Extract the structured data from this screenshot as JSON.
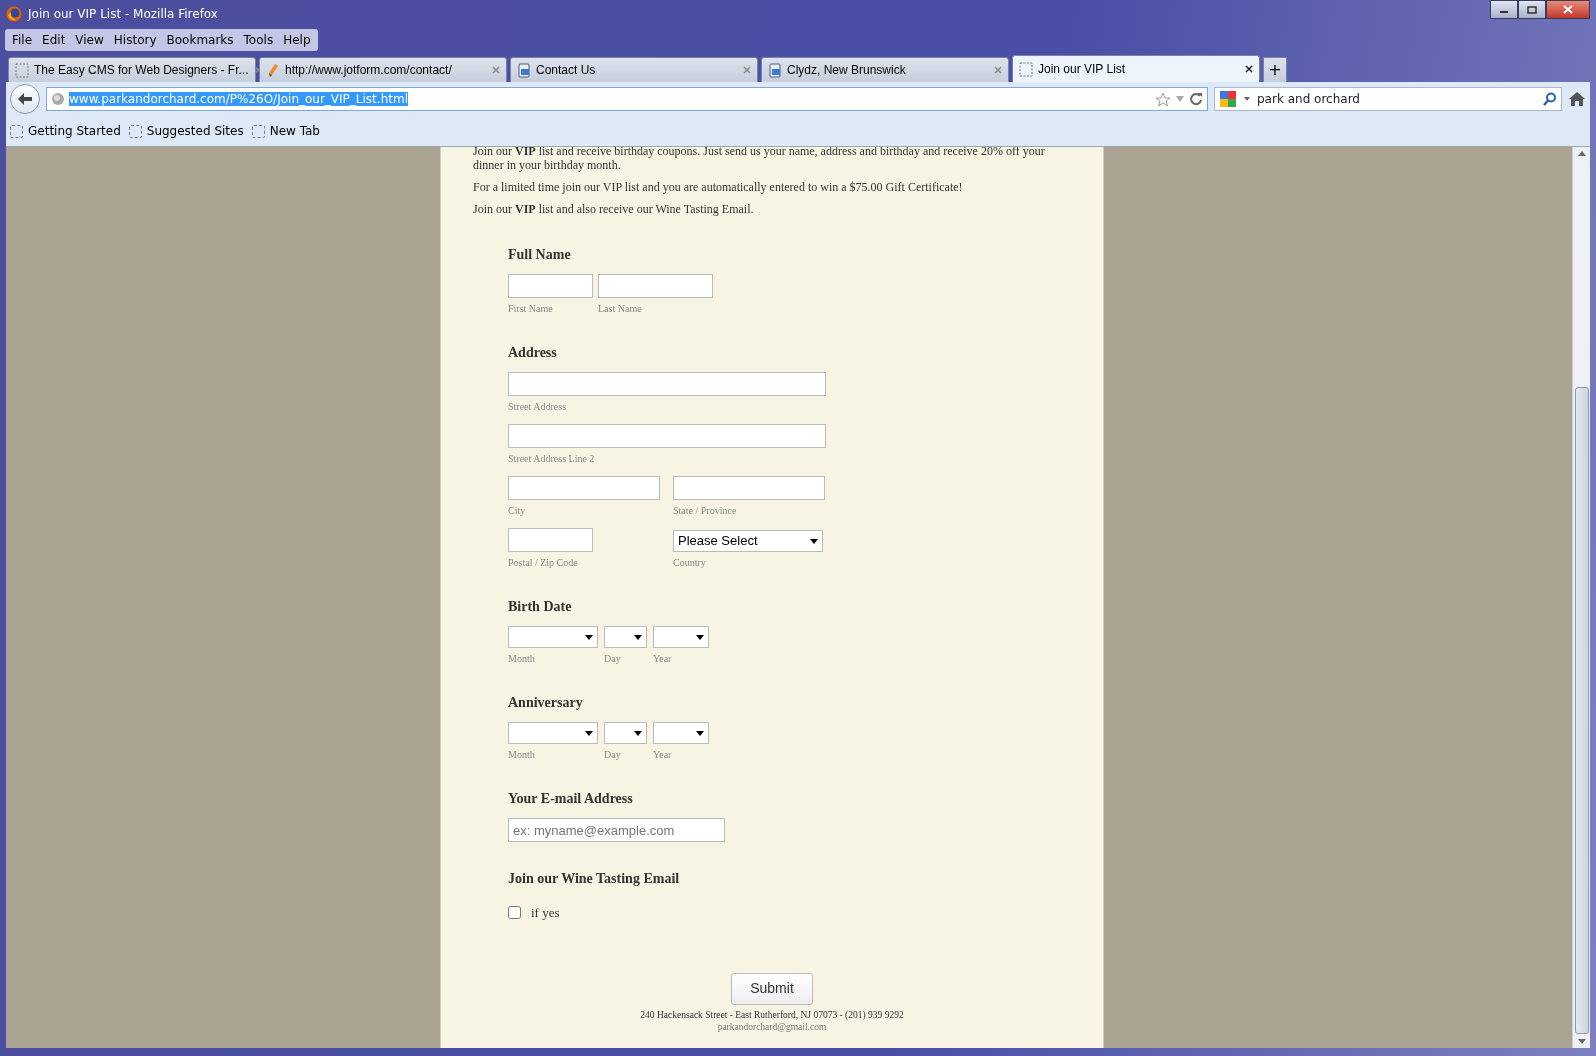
{
  "window": {
    "title": "Join our VIP List - Mozilla Firefox"
  },
  "menu": [
    "File",
    "Edit",
    "View",
    "History",
    "Bookmarks",
    "Tools",
    "Help"
  ],
  "tabs": [
    {
      "label": "The Easy CMS for Web Designers - Fr...",
      "kind": "blank",
      "selected": false
    },
    {
      "label": "http://www.jotform.com/contact/",
      "kind": "pencil",
      "selected": false
    },
    {
      "label": "Contact Us",
      "kind": "document",
      "selected": false
    },
    {
      "label": "Clydz, New Brunswick",
      "kind": "document",
      "selected": false
    },
    {
      "label": "Join our VIP List",
      "kind": "blank",
      "selected": true
    }
  ],
  "new_tab": "+",
  "address": {
    "value": "www.parkandorchard.com/P%26O/Join_our_VIP_List.html",
    "selected": true
  },
  "search": {
    "value": "park and orchard"
  },
  "bookmarks": [
    "Getting Started",
    "Suggested Sites",
    "New Tab"
  ],
  "intro": [
    "Join our **VIP** list and receive birthday coupons. Just send us your name, address and birthday and receive 20% off your dinner in your birthday month.",
    "For a limited time join our VIP list and you are automatically entered to win a $75.00 Gift Certificate!",
    "Join our **VIP** list and also receive our Wine Tasting Email."
  ],
  "form": [
    {
      "kind": "name",
      "label": "Full Name",
      "sublabels": [
        "First Name",
        "Last Name"
      ]
    },
    {
      "kind": "address",
      "label": "Address",
      "sublabels": [
        "Street Address",
        "Street Address Line 2",
        "City",
        "State / Province",
        "Postal / Zip Code",
        "Country"
      ],
      "country_value": "Please Select"
    },
    {
      "kind": "date",
      "label": "Birth Date",
      "sublabels": [
        "Month",
        "Day",
        "Year"
      ]
    },
    {
      "kind": "date",
      "label": "Anniversary",
      "sublabels": [
        "Month",
        "Day",
        "Year"
      ]
    },
    {
      "kind": "email",
      "label": "Your E-mail Address",
      "placeholder": "ex: myname@example.com"
    },
    {
      "kind": "checkbox",
      "label": "Join our Wine Tasting Email",
      "option": "if yes",
      "checked": false
    }
  ],
  "submit": "Submit",
  "footer": [
    "240 Hackensack Street - East Rutherford, NJ 07073 - (201) 939 9292",
    "parkandorchard@gmail.com"
  ]
}
